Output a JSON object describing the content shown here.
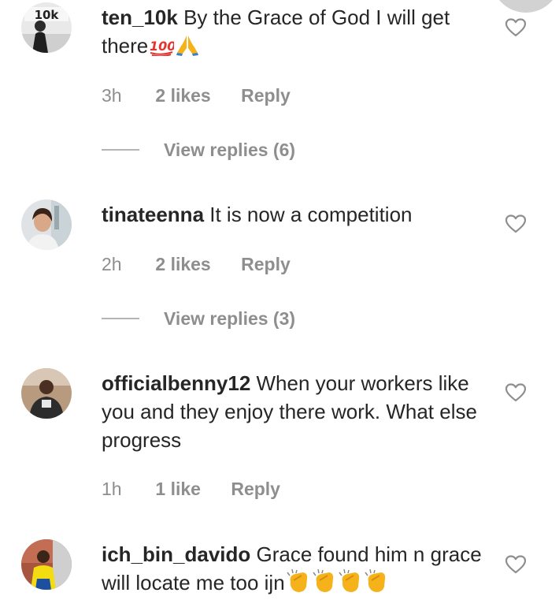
{
  "comments": [
    {
      "username": "ten_10k",
      "text": "By the Grace of God I will get there",
      "emojis": [
        "hundred-points-emoji",
        "folded-hands-emoji"
      ],
      "time": "3h",
      "likes": "2 likes",
      "reply": "Reply",
      "view_replies": "View replies (6)"
    },
    {
      "username": "tinateenna",
      "text": "It is now a competition",
      "time": "2h",
      "likes": "2 likes",
      "reply": "Reply",
      "view_replies": "View replies (3)"
    },
    {
      "username": "officialbenny12",
      "text": "When your workers like you and they enjoy there work. What else progress",
      "time": "1h",
      "likes": "1 like",
      "reply": "Reply"
    },
    {
      "username": "ich_bin_davido",
      "text": "Grace found him n grace will locate me too ijn",
      "emojis": [
        "clapping-hands-emoji",
        "clapping-hands-emoji",
        "clapping-hands-emoji",
        "clapping-hands-emoji"
      ]
    }
  ],
  "colors": {
    "text": "#262626",
    "secondary": "#8e8e8e",
    "heart_outline": "#8e8e8e"
  }
}
